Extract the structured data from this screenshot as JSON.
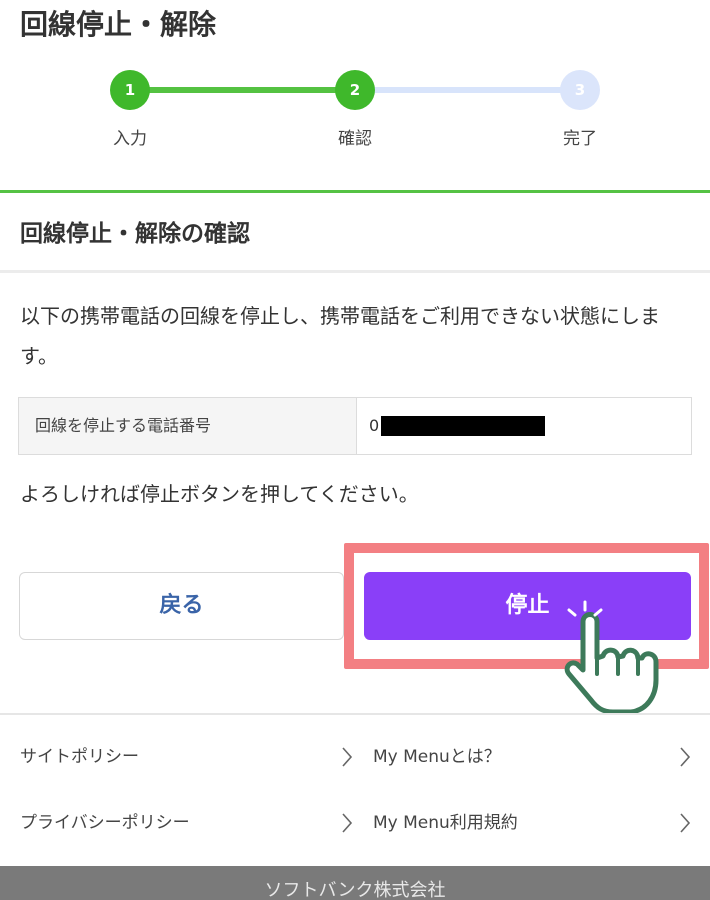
{
  "page": {
    "title": "回線停止・解除"
  },
  "stepper": {
    "steps": [
      {
        "number": "1",
        "label": "入力",
        "state": "done"
      },
      {
        "number": "2",
        "label": "確認",
        "state": "current"
      },
      {
        "number": "3",
        "label": "完了",
        "state": "pending"
      }
    ]
  },
  "section": {
    "title": "回線停止・解除の確認"
  },
  "description": "以下の携帯電話の回線を停止し、携帯電話をご利用できない状態にします。",
  "info": {
    "key": "回線を停止する電話番号",
    "value_prefix": "0"
  },
  "confirm_text": "よろしければ停止ボタンを押してください。",
  "buttons": {
    "back_label": "戻る",
    "stop_label": "停止"
  },
  "footer": {
    "links": [
      {
        "label": "サイトポリシー"
      },
      {
        "label": "My Menuとは？"
      },
      {
        "label": "プライバシーポリシー"
      },
      {
        "label": "My Menu利用規約"
      }
    ],
    "company": "ソフトバンク株式会社"
  },
  "colors": {
    "accent_green": "#3fb82b",
    "stop_button": "#8a3ff8",
    "highlight": "#f37f83",
    "back_text": "#3a64a8"
  },
  "icons": {
    "pointer": "hand-pointer-icon",
    "chevron": "chevron-right-icon"
  }
}
